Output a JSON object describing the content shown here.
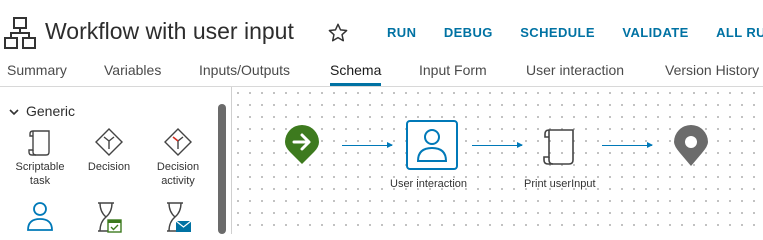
{
  "header": {
    "title": "Workflow with user input",
    "actions": [
      "RUN",
      "DEBUG",
      "SCHEDULE",
      "VALIDATE",
      "ALL RU"
    ]
  },
  "tabs": [
    {
      "label": "Summary"
    },
    {
      "label": "Variables"
    },
    {
      "label": "Inputs/Outputs"
    },
    {
      "label": "Schema",
      "active": true
    },
    {
      "label": "Input Form"
    },
    {
      "label": "User interaction"
    },
    {
      "label": "Version History"
    }
  ],
  "palette": {
    "group": "Generic",
    "items": [
      {
        "label": "Scriptable task",
        "icon": "scroll-icon"
      },
      {
        "label": "Decision",
        "icon": "decision-icon"
      },
      {
        "label": "Decision activity",
        "icon": "decision-activity-icon"
      },
      {
        "label": "",
        "icon": "user-icon"
      },
      {
        "label": "",
        "icon": "hourglass-calendar-icon"
      },
      {
        "label": "",
        "icon": "hourglass-mail-icon"
      }
    ]
  },
  "canvas": {
    "nodes": [
      {
        "label": "",
        "icon": "start-arrow-icon"
      },
      {
        "label": "User interaction",
        "icon": "user-icon"
      },
      {
        "label": "Print userInput",
        "icon": "scroll-icon"
      },
      {
        "label": "",
        "icon": "end-pin-icon"
      }
    ]
  },
  "colors": {
    "accent": "#0072a3",
    "start": "#3d7a1e",
    "end": "#6b6b6b"
  }
}
